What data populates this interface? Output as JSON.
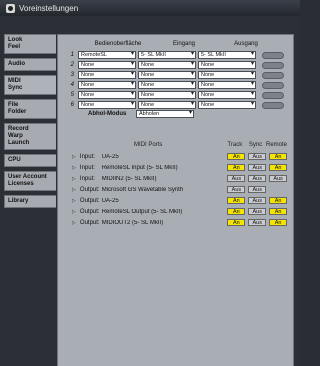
{
  "window": {
    "title": "Voreinstellungen"
  },
  "sidebar": {
    "tabs": [
      {
        "lines": [
          "Look",
          "Feel"
        ]
      },
      {
        "lines": [
          "Audio"
        ]
      },
      {
        "lines": [
          "MIDI",
          "Sync"
        ]
      },
      {
        "lines": [
          "File",
          "Folder"
        ]
      },
      {
        "lines": [
          "Record",
          "Warp",
          "Launch"
        ]
      },
      {
        "lines": [
          "CPU"
        ]
      },
      {
        "lines": [
          "User Account",
          "Licenses"
        ]
      },
      {
        "lines": [
          "Library"
        ]
      }
    ]
  },
  "control_surfaces": {
    "headers": {
      "surface": "Bedienoberfläche",
      "input": "Eingang",
      "output": "Ausgang"
    },
    "rows": [
      {
        "n": "1",
        "surface": "RemoteSL",
        "input": "5- SL MkII",
        "output": "5- SL MkII"
      },
      {
        "n": "2",
        "surface": "None",
        "input": "None",
        "output": "None"
      },
      {
        "n": "3",
        "surface": "None",
        "input": "None",
        "output": "None"
      },
      {
        "n": "4",
        "surface": "None",
        "input": "None",
        "output": "None"
      },
      {
        "n": "5",
        "surface": "None",
        "input": "None",
        "output": "None"
      },
      {
        "n": "6",
        "surface": "None",
        "input": "None",
        "output": "None"
      }
    ]
  },
  "takeover": {
    "label": "Abhol-Modus",
    "value": "Abholen"
  },
  "midi_ports": {
    "headers": {
      "ports": "MIDI Ports",
      "track": "Track",
      "sync": "Sync",
      "remote": "Remote"
    },
    "rows": [
      {
        "type": "Input:",
        "name": "UA-25",
        "track": "An",
        "sync": "Aus",
        "remote": "An"
      },
      {
        "type": "Input:",
        "name": "RemoteSL Input (5- SL MkII)",
        "track": "An",
        "sync": "Aus",
        "remote": "An"
      },
      {
        "type": "Input:",
        "name": "MIDIIN2 (5- SL MkII)",
        "track": "Aus",
        "sync": "Aus",
        "remote": "Aus"
      },
      {
        "type": "Output:",
        "name": "Microsoft GS Wavetable Synth",
        "track": "Aus",
        "sync": "Aus",
        "remote": ""
      },
      {
        "type": "Output:",
        "name": "UA-25",
        "track": "An",
        "sync": "Aus",
        "remote": "An"
      },
      {
        "type": "Output:",
        "name": "RemoteSL Output (5- SL MkII)",
        "track": "An",
        "sync": "Aus",
        "remote": "An"
      },
      {
        "type": "Output:",
        "name": "MIDIOUT2 (5- SL MkII)",
        "track": "An",
        "sync": "Aus",
        "remote": "An"
      }
    ]
  }
}
